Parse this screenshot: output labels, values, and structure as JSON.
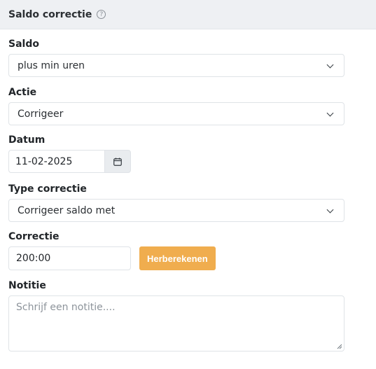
{
  "header": {
    "title": "Saldo correctie",
    "help_icon": "question-circle-icon"
  },
  "saldo": {
    "label": "Saldo",
    "value": "plus min uren"
  },
  "actie": {
    "label": "Actie",
    "value": "Corrigeer"
  },
  "datum": {
    "label": "Datum",
    "value": "11-02-2025",
    "icon": "calendar-icon"
  },
  "type_correctie": {
    "label": "Type correctie",
    "value": "Corrigeer saldo met"
  },
  "correctie": {
    "label": "Correctie",
    "value": "200:00",
    "button_label": "Herberekenen",
    "button_color": "#f0ad4e"
  },
  "notitie": {
    "label": "Notitie",
    "placeholder": "Schrijf een notitie...."
  }
}
